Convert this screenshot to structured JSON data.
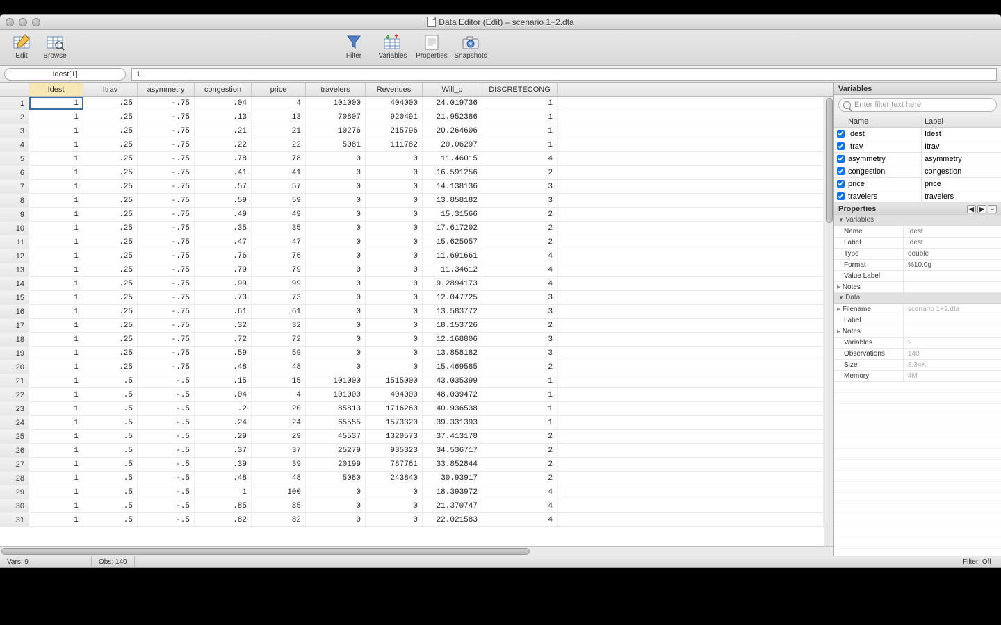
{
  "window": {
    "title": "Data Editor (Edit) – scenario 1+2.dta"
  },
  "toolbar": {
    "edit": "Edit",
    "browse": "Browse",
    "filter": "Filter",
    "variables": "Variables",
    "properties": "Properties",
    "snapshots": "Snapshots"
  },
  "formula": {
    "cellref": "Idest[1]",
    "value": "1"
  },
  "columns": [
    "Idest",
    "Itrav",
    "asymmetry",
    "congestion",
    "price",
    "travelers",
    "Revenues",
    "Will_p",
    "DISCRETECONG"
  ],
  "rows": [
    [
      "1",
      ".25",
      "-.75",
      ".04",
      "4",
      "101000",
      "404000",
      "24.019736",
      "1"
    ],
    [
      "1",
      ".25",
      "-.75",
      ".13",
      "13",
      "70807",
      "920491",
      "21.952386",
      "1"
    ],
    [
      "1",
      ".25",
      "-.75",
      ".21",
      "21",
      "10276",
      "215796",
      "20.264606",
      "1"
    ],
    [
      "1",
      ".25",
      "-.75",
      ".22",
      "22",
      "5081",
      "111782",
      "20.06297",
      "1"
    ],
    [
      "1",
      ".25",
      "-.75",
      ".78",
      "78",
      "0",
      "0",
      "11.46015",
      "4"
    ],
    [
      "1",
      ".25",
      "-.75",
      ".41",
      "41",
      "0",
      "0",
      "16.591256",
      "2"
    ],
    [
      "1",
      ".25",
      "-.75",
      ".57",
      "57",
      "0",
      "0",
      "14.138136",
      "3"
    ],
    [
      "1",
      ".25",
      "-.75",
      ".59",
      "59",
      "0",
      "0",
      "13.858182",
      "3"
    ],
    [
      "1",
      ".25",
      "-.75",
      ".49",
      "49",
      "0",
      "0",
      "15.31566",
      "2"
    ],
    [
      "1",
      ".25",
      "-.75",
      ".35",
      "35",
      "0",
      "0",
      "17.617202",
      "2"
    ],
    [
      "1",
      ".25",
      "-.75",
      ".47",
      "47",
      "0",
      "0",
      "15.625057",
      "2"
    ],
    [
      "1",
      ".25",
      "-.75",
      ".76",
      "76",
      "0",
      "0",
      "11.691661",
      "4"
    ],
    [
      "1",
      ".25",
      "-.75",
      ".79",
      "79",
      "0",
      "0",
      "11.34612",
      "4"
    ],
    [
      "1",
      ".25",
      "-.75",
      ".99",
      "99",
      "0",
      "0",
      "9.2894173",
      "4"
    ],
    [
      "1",
      ".25",
      "-.75",
      ".73",
      "73",
      "0",
      "0",
      "12.047725",
      "3"
    ],
    [
      "1",
      ".25",
      "-.75",
      ".61",
      "61",
      "0",
      "0",
      "13.583772",
      "3"
    ],
    [
      "1",
      ".25",
      "-.75",
      ".32",
      "32",
      "0",
      "0",
      "18.153726",
      "2"
    ],
    [
      "1",
      ".25",
      "-.75",
      ".72",
      "72",
      "0",
      "0",
      "12.168806",
      "3"
    ],
    [
      "1",
      ".25",
      "-.75",
      ".59",
      "59",
      "0",
      "0",
      "13.858182",
      "3"
    ],
    [
      "1",
      ".25",
      "-.75",
      ".48",
      "48",
      "0",
      "0",
      "15.469585",
      "2"
    ],
    [
      "1",
      ".5",
      "-.5",
      ".15",
      "15",
      "101000",
      "1515000",
      "43.035399",
      "1"
    ],
    [
      "1",
      ".5",
      "-.5",
      ".04",
      "4",
      "101000",
      "404000",
      "48.039472",
      "1"
    ],
    [
      "1",
      ".5",
      "-.5",
      ".2",
      "20",
      "85813",
      "1716260",
      "40.936538",
      "1"
    ],
    [
      "1",
      ".5",
      "-.5",
      ".24",
      "24",
      "65555",
      "1573320",
      "39.331393",
      "1"
    ],
    [
      "1",
      ".5",
      "-.5",
      ".29",
      "29",
      "45537",
      "1320573",
      "37.413178",
      "2"
    ],
    [
      "1",
      ".5",
      "-.5",
      ".37",
      "37",
      "25279",
      "935323",
      "34.536717",
      "2"
    ],
    [
      "1",
      ".5",
      "-.5",
      ".39",
      "39",
      "20199",
      "787761",
      "33.852844",
      "2"
    ],
    [
      "1",
      ".5",
      "-.5",
      ".48",
      "48",
      "5080",
      "243840",
      "30.93917",
      "2"
    ],
    [
      "1",
      ".5",
      "-.5",
      "1",
      "100",
      "0",
      "0",
      "18.393972",
      "4"
    ],
    [
      "1",
      ".5",
      "-.5",
      ".85",
      "85",
      "0",
      "0",
      "21.370747",
      "4"
    ],
    [
      "1",
      ".5",
      "-.5",
      ".82",
      "82",
      "0",
      "0",
      "22.021583",
      "4"
    ]
  ],
  "variablesPanel": {
    "title": "Variables",
    "filterPlaceholder": "Enter filter text here",
    "headers": {
      "name": "Name",
      "label": "Label"
    },
    "items": [
      {
        "name": "Idest",
        "label": "Idest"
      },
      {
        "name": "Itrav",
        "label": "Itrav"
      },
      {
        "name": "asymmetry",
        "label": "asymmetry"
      },
      {
        "name": "congestion",
        "label": "congestion"
      },
      {
        "name": "price",
        "label": "price"
      },
      {
        "name": "travelers",
        "label": "travelers"
      }
    ]
  },
  "propertiesPanel": {
    "title": "Properties",
    "sections": {
      "vars": {
        "title": "Variables",
        "rows": [
          {
            "k": "Name",
            "v": "Idest"
          },
          {
            "k": "Label",
            "v": "Idest"
          },
          {
            "k": "Type",
            "v": "double"
          },
          {
            "k": "Format",
            "v": "%10.0g"
          },
          {
            "k": "Value Label",
            "v": ""
          },
          {
            "k": "Notes",
            "v": "",
            "sub": true
          }
        ]
      },
      "data": {
        "title": "Data",
        "rows": [
          {
            "k": "Filename",
            "v": "scenario 1+2.dta",
            "sub": true,
            "dim": true
          },
          {
            "k": "Label",
            "v": ""
          },
          {
            "k": "Notes",
            "v": "",
            "sub": true
          },
          {
            "k": "Variables",
            "v": "9",
            "dim": true
          },
          {
            "k": "Observations",
            "v": "140",
            "dim": true
          },
          {
            "k": "Size",
            "v": "8.34K",
            "dim": true
          },
          {
            "k": "Memory",
            "v": "4M",
            "dim": true
          }
        ]
      }
    }
  },
  "status": {
    "vars": "Vars: 9",
    "obs": "Obs: 140",
    "filter": "Filter: Off"
  }
}
